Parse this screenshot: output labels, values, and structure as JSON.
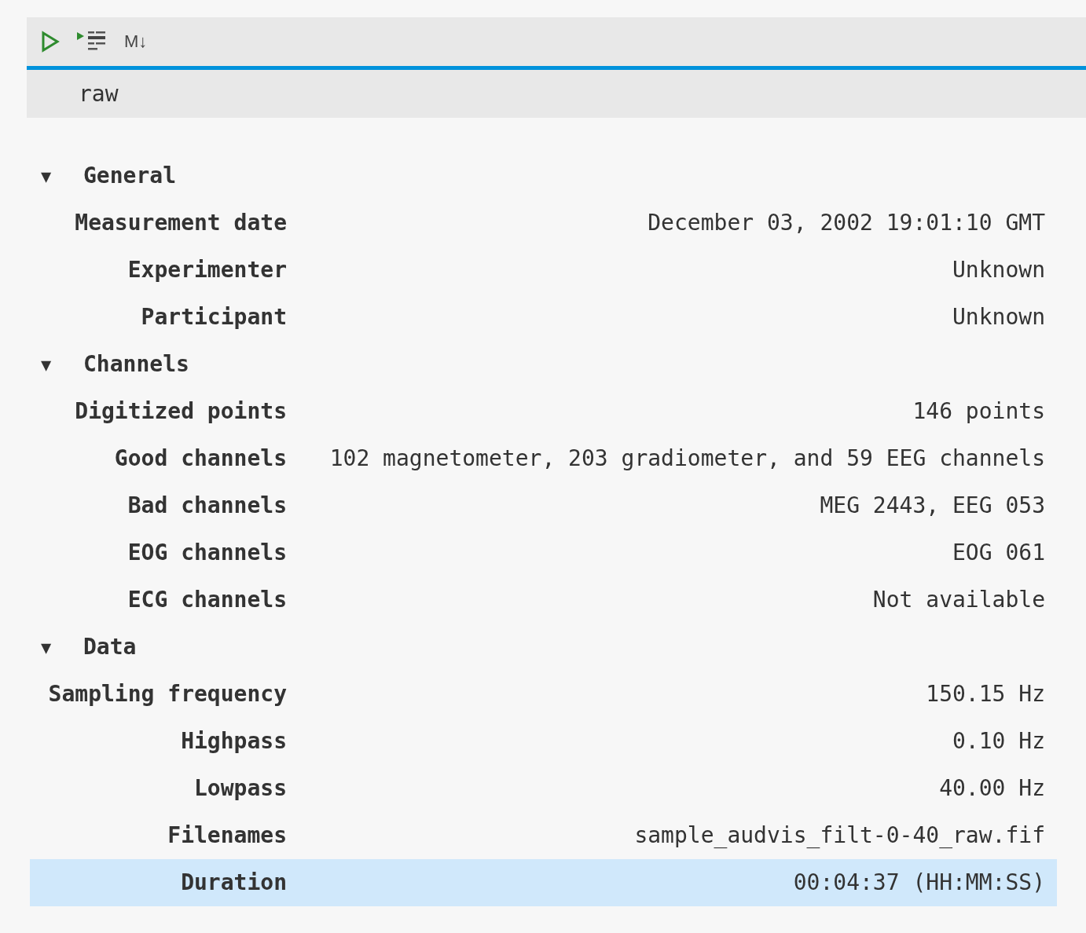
{
  "toolbar": {
    "markdown_label": "M↓"
  },
  "cell": {
    "code": "raw"
  },
  "sections": [
    {
      "toggle": "▼",
      "title": "General",
      "expanded": true,
      "rows": [
        {
          "label": "Measurement date",
          "value": "December 03, 2002 19:01:10 GMT",
          "selected": false
        },
        {
          "label": "Experimenter",
          "value": "Unknown",
          "selected": false
        },
        {
          "label": "Participant",
          "value": "Unknown",
          "selected": false
        }
      ]
    },
    {
      "toggle": "▼",
      "title": "Channels",
      "expanded": true,
      "rows": [
        {
          "label": "Digitized points",
          "value": "146 points",
          "selected": false
        },
        {
          "label": "Good channels",
          "value": "102 magnetometer, 203 gradiometer, and 59 EEG channels",
          "selected": false
        },
        {
          "label": "Bad channels",
          "value": "MEG 2443, EEG 053",
          "selected": false
        },
        {
          "label": "EOG channels",
          "value": "EOG 061",
          "selected": false
        },
        {
          "label": "ECG channels",
          "value": "Not available",
          "selected": false
        }
      ]
    },
    {
      "toggle": "▼",
      "title": "Data",
      "expanded": true,
      "rows": [
        {
          "label": "Sampling frequency",
          "value": "150.15 Hz",
          "selected": false
        },
        {
          "label": "Highpass",
          "value": "0.10 Hz",
          "selected": false
        },
        {
          "label": "Lowpass",
          "value": "40.00 Hz",
          "selected": false
        },
        {
          "label": "Filenames",
          "value": "sample_audvis_filt-0-40_raw.fif",
          "selected": false
        },
        {
          "label": "Duration",
          "value": "00:04:37 (HH:MM:SS)",
          "selected": true
        }
      ]
    }
  ]
}
